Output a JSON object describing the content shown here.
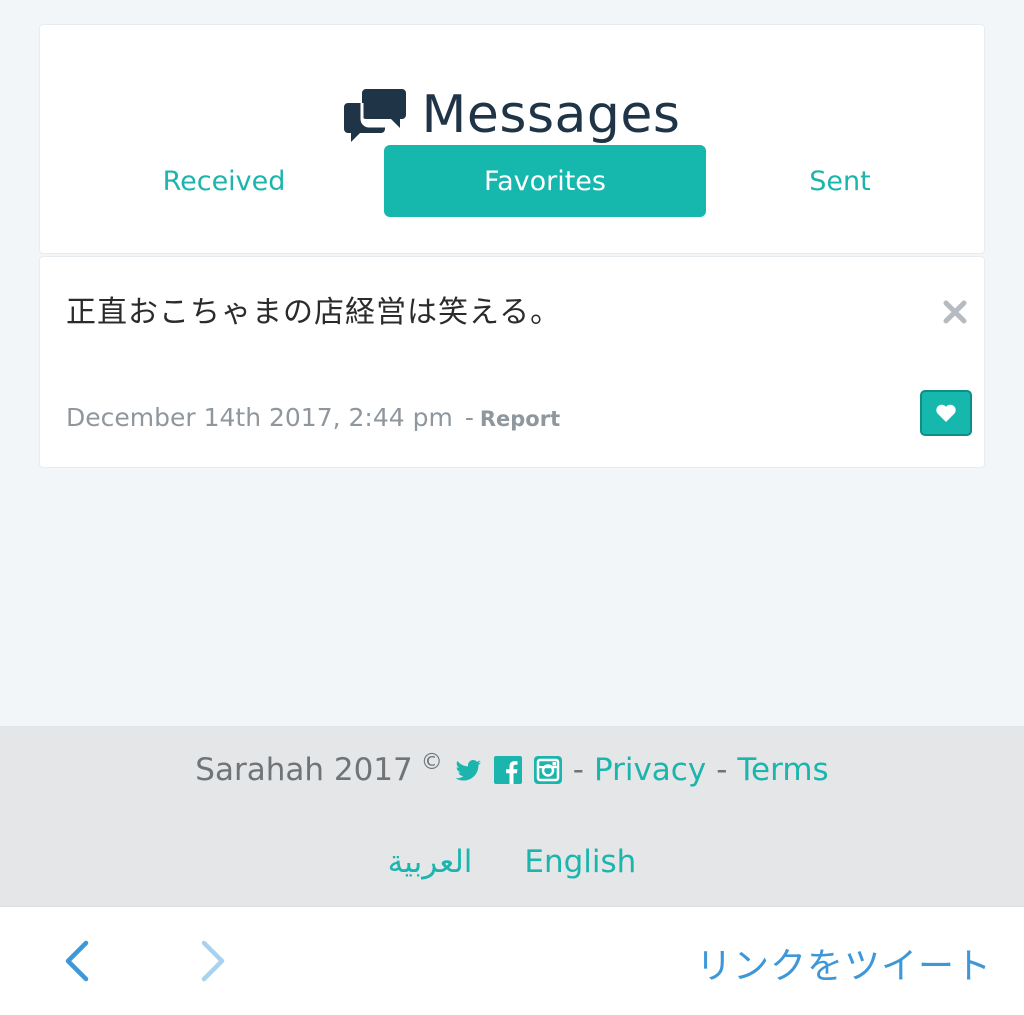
{
  "header": {
    "title": "Messages",
    "title_icon": "chat-bubbles-icon"
  },
  "tabs": [
    {
      "label": "Received",
      "active": false
    },
    {
      "label": "Favorites",
      "active": true
    },
    {
      "label": "Sent",
      "active": false
    }
  ],
  "message": {
    "text": "正直おこちゃまの店経営は笑える。",
    "timestamp": "December 14th 2017, 2:44 pm",
    "separator": "-",
    "report_label": "Report",
    "favorited": true
  },
  "footer": {
    "copyright": "Sarahah 2017",
    "copyright_symbol": "©",
    "social_icons": [
      "twitter-icon",
      "facebook-icon",
      "instagram-icon"
    ],
    "dash": "-",
    "privacy_label": "Privacy",
    "terms_label": "Terms",
    "languages": [
      "العربية",
      "English"
    ]
  },
  "browser_bar": {
    "tweet_label": "リンクをツイート"
  },
  "colors": {
    "accent": "#16b7ad",
    "title": "#1f3547",
    "background": "#f3f6f9",
    "footer_bg": "#e4e6e8",
    "link_blue": "#3d97d8"
  }
}
